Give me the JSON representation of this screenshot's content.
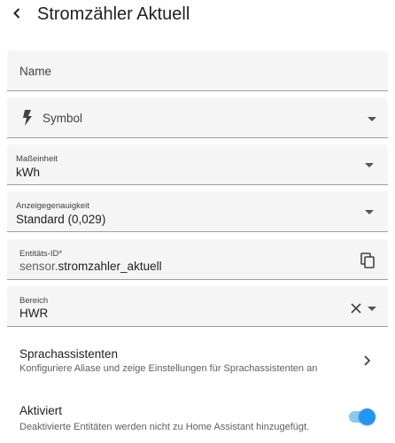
{
  "header": {
    "title": "Stromzähler Aktuell",
    "back_icon": "chevron-left-icon"
  },
  "fields": {
    "name": {
      "placeholder": "Name"
    },
    "symbol": {
      "placeholder": "Symbol",
      "icon": "lightning-bolt-icon"
    },
    "unit": {
      "label": "Maßeinheit",
      "value": "kWh"
    },
    "precision": {
      "label": "Anzeigegenauigkeit",
      "value": "Standard (0,029)"
    },
    "entity_id": {
      "label": "Entitäts-ID*",
      "prefix": "sensor.",
      "value": "stromzahler_aktuell",
      "copy_icon": "copy-icon"
    },
    "area": {
      "label": "Bereich",
      "value": "HWR",
      "clear_icon": "close-icon"
    }
  },
  "voice_assistants": {
    "title": "Sprachassistenten",
    "subtitle": "Konfiguriere Aliase und zeige Einstellungen für Sprachassistenten an"
  },
  "enabled": {
    "title": "Aktiviert",
    "subtitle": "Deaktivierte Entitäten werden nicht zu Home Assistant hinzugefügt.",
    "state": true,
    "accent": "#2196f3"
  }
}
